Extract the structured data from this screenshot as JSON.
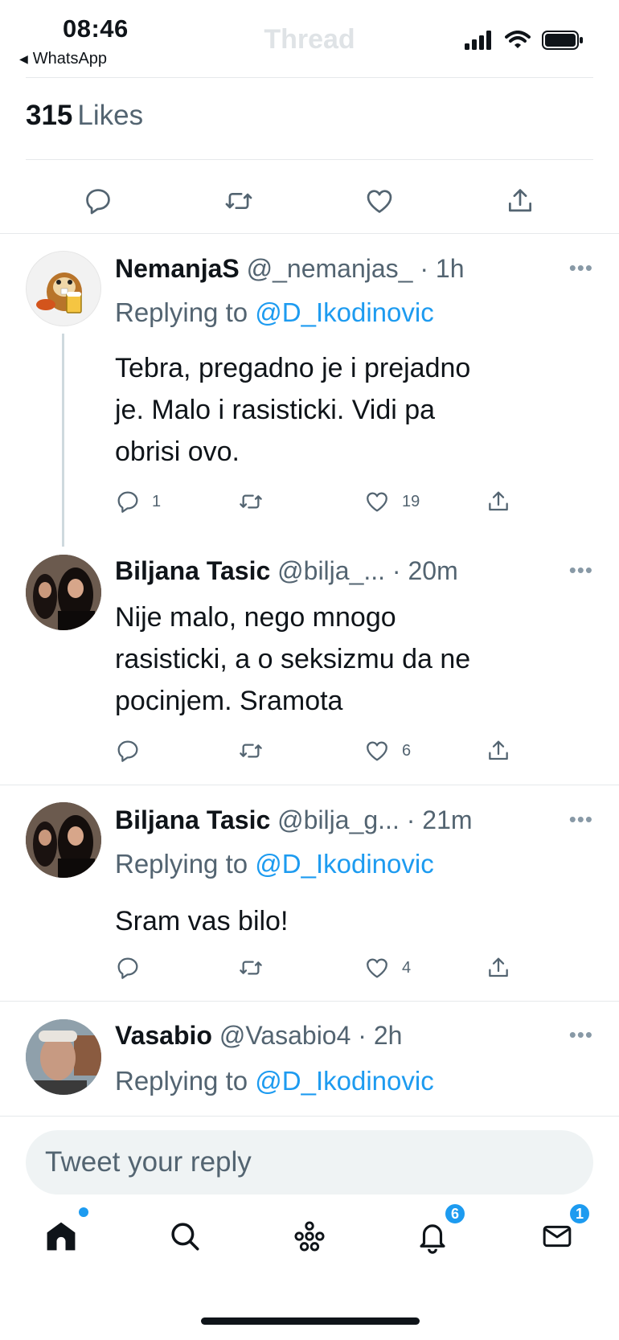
{
  "status_bar": {
    "time": "08:46",
    "back_app": "WhatsApp",
    "ghost_title": "Thread"
  },
  "likes": {
    "count": "315",
    "label": "Likes"
  },
  "replies": [
    {
      "name": "NemanjaS",
      "handle": "@_nemanjas_",
      "time": "1h",
      "replying_prefix": "Replying to",
      "replying_mention": "@D_Ikodinovic",
      "text_lines": [
        "Tebra, pregadno je i prejadno",
        "je. Malo i rasisticki. Vidi pa",
        "obrisi ovo."
      ],
      "reply_count": "1",
      "like_count": "19"
    },
    {
      "name": "Biljana Tasic",
      "handle": "@bilja_...",
      "time": "20m",
      "text_lines": [
        "Nije malo, nego mnogo",
        "rasisticki, a o seksizmu da ne",
        "pocinjem. Sramota"
      ],
      "reply_count": "",
      "like_count": "6"
    },
    {
      "name": "Biljana Tasic",
      "handle": "@bilja_g...",
      "time": "21m",
      "replying_prefix": "Replying to",
      "replying_mention": "@D_Ikodinovic",
      "text_lines": [
        "Sram vas bilo!"
      ],
      "reply_count": "",
      "like_count": "4"
    },
    {
      "name": "Vasabio",
      "handle": "@Vasabio4",
      "time": "2h",
      "replying_prefix": "Replying to",
      "replying_mention": "@D_Ikodinovic"
    }
  ],
  "compose": {
    "placeholder": "Tweet your reply"
  },
  "tabbar": {
    "notifications_badge": "6",
    "messages_badge": "1"
  },
  "colors": {
    "accent": "#1d9bf0",
    "text": "#0f1419",
    "secondary": "#536471",
    "divider": "#e6e9eb"
  },
  "icons": [
    "reply-icon",
    "retweet-icon",
    "like-icon",
    "share-icon",
    "more-icon",
    "home-icon",
    "search-icon",
    "spaces-icon",
    "notifications-icon",
    "messages-icon",
    "signal-icon",
    "wifi-icon",
    "battery-icon"
  ]
}
